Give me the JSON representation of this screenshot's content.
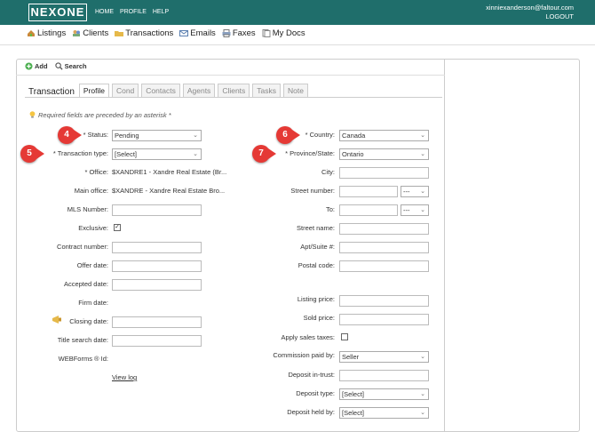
{
  "header": {
    "logo": "NEXONE",
    "nav": [
      "HOME",
      "PROFILE",
      "HELP"
    ],
    "user_email": "xinniexanderson@faltour.com",
    "logout": "LOGOUT"
  },
  "modules": [
    {
      "label": "Listings",
      "icon": "house-icon"
    },
    {
      "label": "Clients",
      "icon": "clients-icon"
    },
    {
      "label": "Transactions",
      "icon": "folder-icon"
    },
    {
      "label": "Emails",
      "icon": "envelope-icon"
    },
    {
      "label": "Faxes",
      "icon": "printer-icon"
    },
    {
      "label": "My Docs",
      "icon": "documents-icon"
    }
  ],
  "toolbar": {
    "add": "Add",
    "search": "Search"
  },
  "tabs": {
    "title": "Transaction",
    "items": [
      "Profile",
      "Cond",
      "Contacts",
      "Agents",
      "Clients",
      "Tasks",
      "Note"
    ],
    "active": "Profile"
  },
  "required_note": "Required fields are preceded by an asterisk *",
  "left": {
    "status": {
      "label": "* Status:",
      "value": "Pending"
    },
    "transaction_type": {
      "label": "* Transaction type:",
      "value": "[Select]"
    },
    "office": {
      "label": "* Office:",
      "value": "$XANDRE1 - Xandre Real Estate (Br..."
    },
    "main_office": {
      "label": "Main office:",
      "value": "$XANDRE - Xandre Real Estate Bro..."
    },
    "mls": {
      "label": "MLS Number:"
    },
    "exclusive": {
      "label": "Exclusive:",
      "checked": true
    },
    "contract_number": {
      "label": "Contract number:"
    },
    "offer_date": {
      "label": "Offer date:"
    },
    "accepted_date": {
      "label": "Accepted date:"
    },
    "firm_date": {
      "label": "Firm date:"
    },
    "closing_date": {
      "label": "Closing date:"
    },
    "title_search_date": {
      "label": "Title search date:"
    },
    "webforms_id": {
      "label": "WEBForms ® Id:"
    },
    "view_log": "View log"
  },
  "right": {
    "country": {
      "label": "* Country:",
      "value": "Canada"
    },
    "province": {
      "label": "* Province/State:",
      "value": "Ontario"
    },
    "city": {
      "label": "City:"
    },
    "street_number": {
      "label": "Street number:",
      "dir": "---"
    },
    "to": {
      "label": "To:",
      "dir": "---"
    },
    "street_name": {
      "label": "Street name:"
    },
    "apt": {
      "label": "Apt/Suite #:"
    },
    "postal": {
      "label": "Postal code:"
    },
    "listing_price": {
      "label": "Listing price:"
    },
    "sold_price": {
      "label": "Sold price:"
    },
    "apply_taxes": {
      "label": "Apply sales taxes:",
      "checked": false
    },
    "commission_paid_by": {
      "label": "Commission paid by:",
      "value": "Seller"
    },
    "deposit_in_trust": {
      "label": "Deposit in-trust:"
    },
    "deposit_type": {
      "label": "Deposit type:",
      "value": "[Select]"
    },
    "deposit_held_by": {
      "label": "Deposit held by:",
      "value": "[Select]"
    }
  },
  "callouts": [
    "4",
    "5",
    "6",
    "7"
  ],
  "colors": {
    "header": "#1f6e6b",
    "callout": "#e53935"
  }
}
